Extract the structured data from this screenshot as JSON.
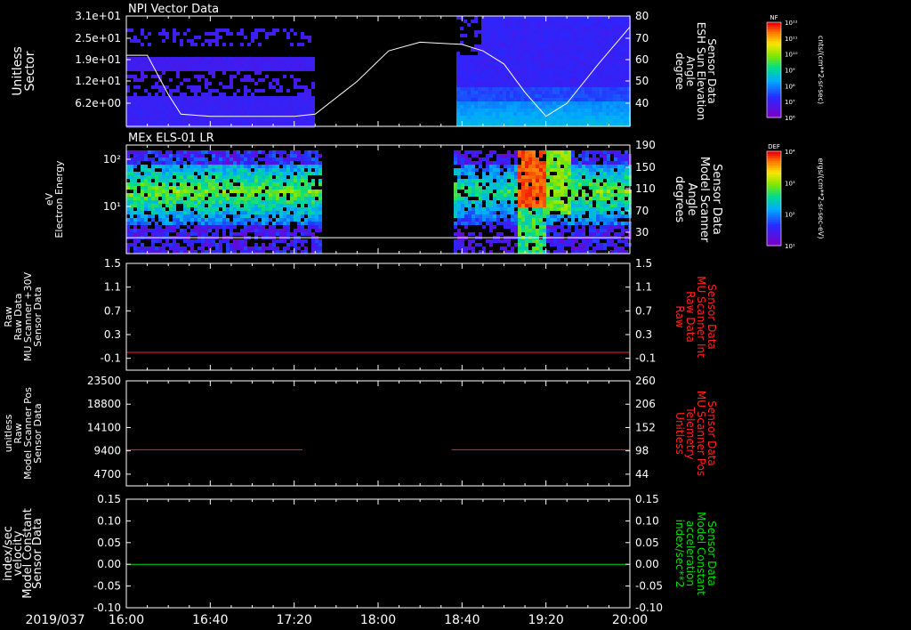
{
  "chart_data": {
    "type": "heatmap",
    "date_label": "2019/037",
    "x_ticks": [
      "16:00",
      "16:40",
      "17:20",
      "18:00",
      "18:40",
      "19:20",
      "20:00"
    ],
    "x_range_hours": [
      16,
      20
    ],
    "panels": [
      {
        "id": "npi",
        "title": "NPI Vector Data",
        "left_label": [
          "Sector",
          "Unitless"
        ],
        "left_ticks": [
          "3.1e+01",
          "2.5e+01",
          "1.9e+01",
          "1.2e+01",
          "6.2e+00"
        ],
        "right_label": [
          "Sensor Data",
          "ESH Sun Elevation",
          "Angle",
          "degree"
        ],
        "right_ticks": [
          "80",
          "70",
          "60",
          "50",
          "40"
        ],
        "right_range": [
          30,
          80
        ],
        "line_color": "#ffffff",
        "line_x": [
          "16:00",
          "16:10",
          "16:20",
          "16:26",
          "16:40",
          "17:00",
          "17:20",
          "17:30",
          "17:50",
          "18:05",
          "18:20",
          "18:40",
          "18:50",
          "19:00",
          "19:10",
          "19:20",
          "19:30",
          "19:45",
          "20:00"
        ],
        "line_y": [
          62,
          62,
          44,
          35,
          34,
          34,
          34,
          35,
          50,
          64,
          68,
          67,
          64,
          58,
          45,
          34,
          40,
          58,
          75
        ],
        "data_gap": [
          "17:26",
          "18:32"
        ]
      },
      {
        "id": "els",
        "title": "MEx ELS-01 LR",
        "left_label": [
          "Electron Energy",
          "eV"
        ],
        "left_ticks": [
          "10²",
          "10¹"
        ],
        "right_label": [
          "Sensor Data",
          "Model Scanner",
          "Angle",
          "degrees"
        ],
        "right_ticks": [
          "190",
          "150",
          "110",
          "70",
          "30"
        ],
        "right_range": [
          10,
          190
        ],
        "line_color": "#ffffff",
        "line_x": [
          "16:00",
          "20:00"
        ],
        "line_y": [
          20,
          20
        ],
        "data_gap": [
          "17:29",
          "18:32"
        ]
      },
      {
        "id": "mu_raw",
        "title": "",
        "left_label": [
          "Sensor Data",
          "MU Scanner +30V",
          "Raw Data",
          "Raw"
        ],
        "left_ticks": [
          "1.5",
          "1.1",
          "0.7",
          "0.3",
          "-0.1"
        ],
        "left_range": [
          -0.3,
          1.5
        ],
        "right_label": [
          "Sensor Data",
          "MU Scanner Int",
          "Raw Data",
          "Raw"
        ],
        "right_ticks": [
          "1.5",
          "1.1",
          "0.7",
          "0.3",
          "-0.1"
        ],
        "line_color": "#ff2020",
        "line_x": [
          "16:00",
          "20:00"
        ],
        "line_y": [
          0.0,
          0.0
        ]
      },
      {
        "id": "mu_pos",
        "title": "",
        "left_label": [
          "Sensor Data",
          "Model Scanner Pos",
          "Raw",
          "unitless"
        ],
        "left_ticks": [
          "23500",
          "18800",
          "14100",
          "9400",
          "4700"
        ],
        "left_range": [
          0,
          23500
        ],
        "right_label": [
          "Sensor Data",
          "MU Scanner Pos",
          "Telemetry",
          "Unitless"
        ],
        "right_ticks": [
          "260",
          "206",
          "152",
          "98",
          "44"
        ],
        "line_color": "#ff2020",
        "line_x": [
          "16:00",
          "17:24",
          "18:35",
          "20:00"
        ],
        "line_y": [
          8100,
          8100,
          8100,
          8100
        ],
        "line_gap": [
          "17:24",
          "18:35"
        ]
      },
      {
        "id": "velocity",
        "title": "",
        "left_label": [
          "Sensor Data",
          "Model Constant",
          "velocity",
          "index/sec"
        ],
        "left_ticks": [
          "0.15",
          "0.10",
          "0.05",
          "0.00",
          "-0.05",
          "-0.10"
        ],
        "left_range": [
          -0.1,
          0.15
        ],
        "right_label": [
          "Sensor Data",
          "Model Constant",
          "acceleration",
          "index/sec**2"
        ],
        "right_ticks": [
          "0.15",
          "0.10",
          "0.05",
          "0.00",
          "-0.05",
          "-0.10"
        ],
        "line_color": "#00dd00",
        "line_x": [
          "16:00",
          "20:00"
        ],
        "line_y": [
          0.0,
          0.0
        ]
      }
    ],
    "colorbars": [
      {
        "label": "NF",
        "units": "cnts/(cm**2-sr-sec)",
        "ticks": [
          "10¹²",
          "10¹¹",
          "10¹⁰",
          "10⁹",
          "10⁸",
          "10⁷",
          "10⁶"
        ]
      },
      {
        "label": "DEF",
        "units": "ergs/(cm**2-sr-sec-eV)",
        "ticks": [
          "10⁴",
          "10³",
          "10²",
          "10¹"
        ]
      }
    ],
    "colors": {
      "background": "#000000",
      "axis": "#ffffff",
      "label_white": "#ffffff",
      "label_red": "#ff2020",
      "label_green": "#00dd00"
    }
  }
}
